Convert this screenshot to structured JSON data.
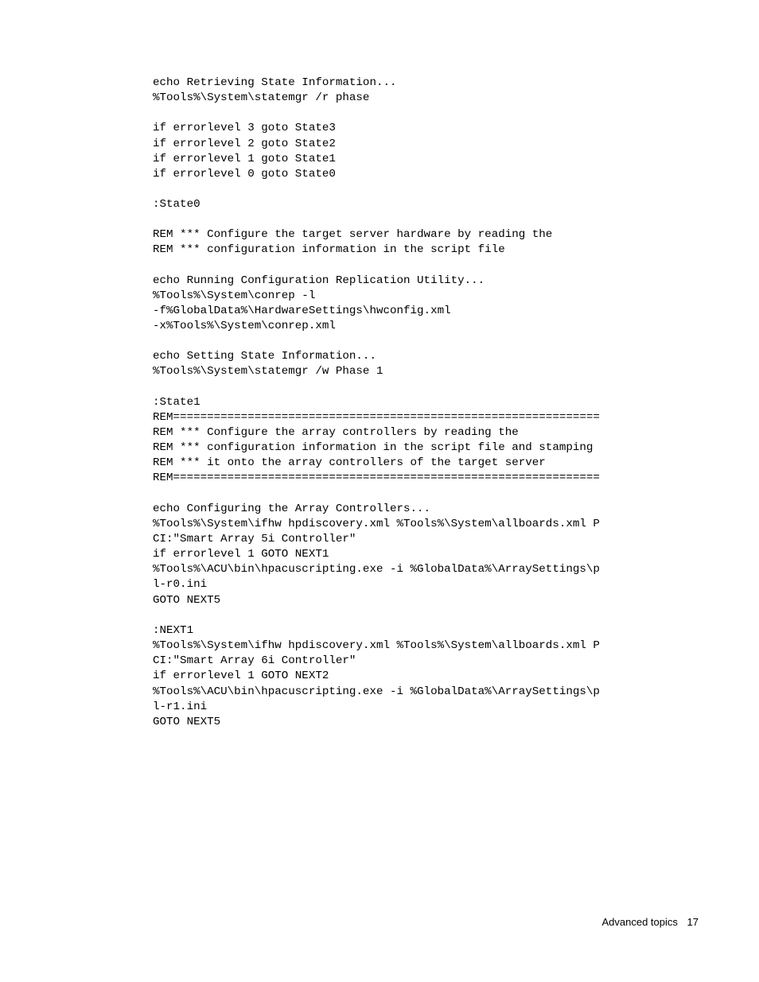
{
  "code_lines": [
    {
      "type": "text",
      "content": "echo Retrieving State Information..."
    },
    {
      "type": "text",
      "content": "%Tools%\\System\\statemgr /r phase"
    },
    {
      "type": "blank"
    },
    {
      "type": "text",
      "content": "if errorlevel 3 goto State3"
    },
    {
      "type": "text",
      "content": "if errorlevel 2 goto State2"
    },
    {
      "type": "text",
      "content": "if errorlevel 1 goto State1"
    },
    {
      "type": "text",
      "content": "if errorlevel 0 goto State0"
    },
    {
      "type": "blank"
    },
    {
      "type": "text",
      "content": ":State0"
    },
    {
      "type": "blank"
    },
    {
      "type": "text",
      "content": "REM *** Configure the target server hardware by reading the"
    },
    {
      "type": "text",
      "content": "REM *** configuration information in the script file"
    },
    {
      "type": "blank"
    },
    {
      "type": "text",
      "content": "echo Running Configuration Replication Utility..."
    },
    {
      "type": "text",
      "content": "%Tools%\\System\\conrep -l\n-f%GlobalData%\\HardwareSettings\\hwconfig.xml\n-x%Tools%\\System\\conrep.xml"
    },
    {
      "type": "blank"
    },
    {
      "type": "text",
      "content": "echo Setting State Information..."
    },
    {
      "type": "text",
      "content": "%Tools%\\System\\statemgr /w Phase 1"
    },
    {
      "type": "blank"
    },
    {
      "type": "text",
      "content": ":State1"
    },
    {
      "type": "text",
      "content": "REM==============================================================="
    },
    {
      "type": "text",
      "content": "REM *** Configure the array controllers by reading the"
    },
    {
      "type": "text",
      "content": "REM *** configuration information in the script file and stamping"
    },
    {
      "type": "text",
      "content": "REM *** it onto the array controllers of the target server"
    },
    {
      "type": "text",
      "content": "REM==============================================================="
    },
    {
      "type": "blank"
    },
    {
      "type": "text",
      "content": "echo Configuring the Array Controllers..."
    },
    {
      "type": "text",
      "content": "%Tools%\\System\\ifhw hpdiscovery.xml %Tools%\\System\\allboards.xml PCI:\"Smart Array 5i Controller\""
    },
    {
      "type": "text",
      "content": "if errorlevel 1 GOTO NEXT1"
    },
    {
      "type": "text",
      "content": "%Tools%\\ACU\\bin\\hpacuscripting.exe -i %GlobalData%\\ArraySettings\\pl-r0.ini"
    },
    {
      "type": "text",
      "content": "GOTO NEXT5"
    },
    {
      "type": "blank"
    },
    {
      "type": "text",
      "content": ":NEXT1"
    },
    {
      "type": "text",
      "content": "%Tools%\\System\\ifhw hpdiscovery.xml %Tools%\\System\\allboards.xml PCI:\"Smart Array 6i Controller\""
    },
    {
      "type": "text",
      "content": "if errorlevel 1 GOTO NEXT2"
    },
    {
      "type": "text",
      "content": "%Tools%\\ACU\\bin\\hpacuscripting.exe -i %GlobalData%\\ArraySettings\\pl-r1.ini"
    },
    {
      "type": "text",
      "content": "GOTO NEXT5"
    }
  ],
  "footer": {
    "text": "Advanced topics",
    "page": "17"
  }
}
